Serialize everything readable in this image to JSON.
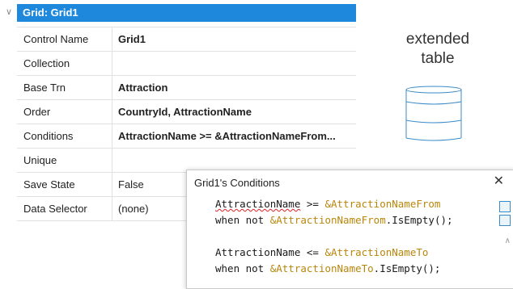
{
  "panel": {
    "header_title": "Grid: Grid1",
    "rows": [
      {
        "name": "Control Name",
        "value": "Grid1",
        "bold": true
      },
      {
        "name": "Collection",
        "value": "",
        "bold": false
      },
      {
        "name": "Base Trn",
        "value": "Attraction",
        "bold": true
      },
      {
        "name": "Order",
        "value": "CountryId, AttractionName",
        "bold": true
      },
      {
        "name": "Conditions",
        "value": "AttractionName >= &AttractionNameFrom...",
        "bold": true
      },
      {
        "name": "Unique",
        "value": "",
        "bold": false
      },
      {
        "name": "Save State",
        "value": "False",
        "bold": false
      },
      {
        "name": "Data Selector",
        "value": "(none)",
        "bold": false
      }
    ]
  },
  "annotation": {
    "line1": "extended",
    "line2": "table"
  },
  "popup": {
    "title": "Grid1's Conditions",
    "close_glyph": "✕",
    "code": {
      "l1_a": "AttractionName",
      "l1_b": " >= ",
      "l1_c": "&AttractionNameFrom",
      "l2_a": "when not ",
      "l2_b": "&AttractionNameFrom",
      "l2_c": ".IsEmpty();",
      "l3_a": "AttractionName <= ",
      "l3_b": "&AttractionNameTo",
      "l4_a": "when not ",
      "l4_b": "&AttractionNameTo",
      "l4_c": ".IsEmpty();"
    }
  },
  "colors": {
    "header_bg": "#1e88dc",
    "variable": "#b8860b",
    "db_icon": "#3a8ac8"
  }
}
